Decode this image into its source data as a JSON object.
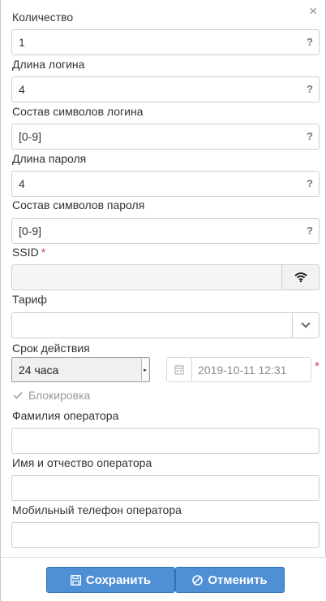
{
  "dialog": {
    "close_symbol": "×"
  },
  "fields": {
    "quantity": {
      "label": "Количество",
      "value": "1",
      "help": "?"
    },
    "login_length": {
      "label": "Длина логина",
      "value": "4",
      "help": "?"
    },
    "login_charset": {
      "label": "Состав символов логина",
      "value": "[0-9]",
      "help": "?"
    },
    "password_length": {
      "label": "Длина пароля",
      "value": "4",
      "help": "?"
    },
    "password_charset": {
      "label": "Состав символов пароля",
      "value": "[0-9]",
      "help": "?"
    },
    "ssid": {
      "label": "SSID",
      "required_mark": "*",
      "value": ""
    },
    "tariff": {
      "label": "Тариф",
      "value": ""
    },
    "validity": {
      "label": "Срок действия",
      "period": "24 часа",
      "datetime": "2019-10-11 12:31",
      "required_mark": "*"
    },
    "block": {
      "label": "Блокировка",
      "checked": true
    },
    "operator_last_name": {
      "label": "Фамилия оператора",
      "value": ""
    },
    "operator_first_middle": {
      "label": "Имя и отчество оператора",
      "value": ""
    },
    "operator_phone": {
      "label": "Мобильный телефон оператора",
      "value": ""
    }
  },
  "footer": {
    "save_label": "Сохранить",
    "cancel_label": "Отменить"
  },
  "colors": {
    "primary_button": "#4f8fd6",
    "required": "#d43f6a"
  },
  "icons": {
    "close": "close-icon",
    "wifi": "wifi-icon",
    "dropdown": "chevron-down-icon",
    "calendar": "calendar-icon",
    "save": "floppy-disk-icon",
    "cancel": "ban-icon"
  }
}
